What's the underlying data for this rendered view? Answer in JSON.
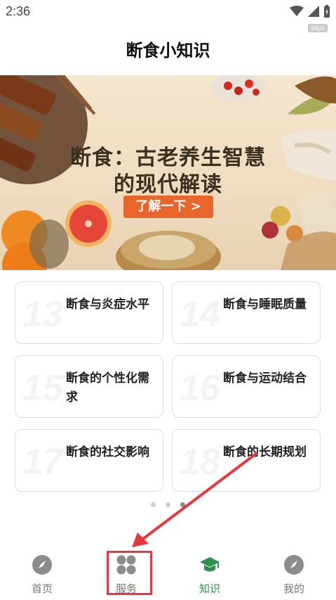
{
  "status_bar": {
    "time": "2:36",
    "fps_badge": "94p5"
  },
  "page": {
    "title": "断食小知识"
  },
  "banner": {
    "headline_line1": "断食：古老养生智慧",
    "headline_line2": "的现代解读",
    "button_label": "了解一下 >"
  },
  "cards": [
    {
      "number": "13",
      "title": "断食与炎症水平"
    },
    {
      "number": "14",
      "title": "断食与睡眠质量"
    },
    {
      "number": "15",
      "title": "断食的个性化需求"
    },
    {
      "number": "16",
      "title": "断食与运动结合"
    },
    {
      "number": "17",
      "title": "断食的社交影响"
    },
    {
      "number": "18",
      "title": "断食的长期规划"
    }
  ],
  "pager": {
    "count": 3,
    "active_index": 2
  },
  "bottom_nav": [
    {
      "label": "首页",
      "icon": "compass-icon"
    },
    {
      "label": "服务",
      "icon": "grid-icon"
    },
    {
      "label": "知识",
      "icon": "graduation-cap-icon",
      "active": true
    },
    {
      "label": "我的",
      "icon": "compass-icon"
    }
  ],
  "colors": {
    "accent_green": "#2f8f4e",
    "banner_button": "#e8652c",
    "highlight_red": "#e8383d"
  }
}
